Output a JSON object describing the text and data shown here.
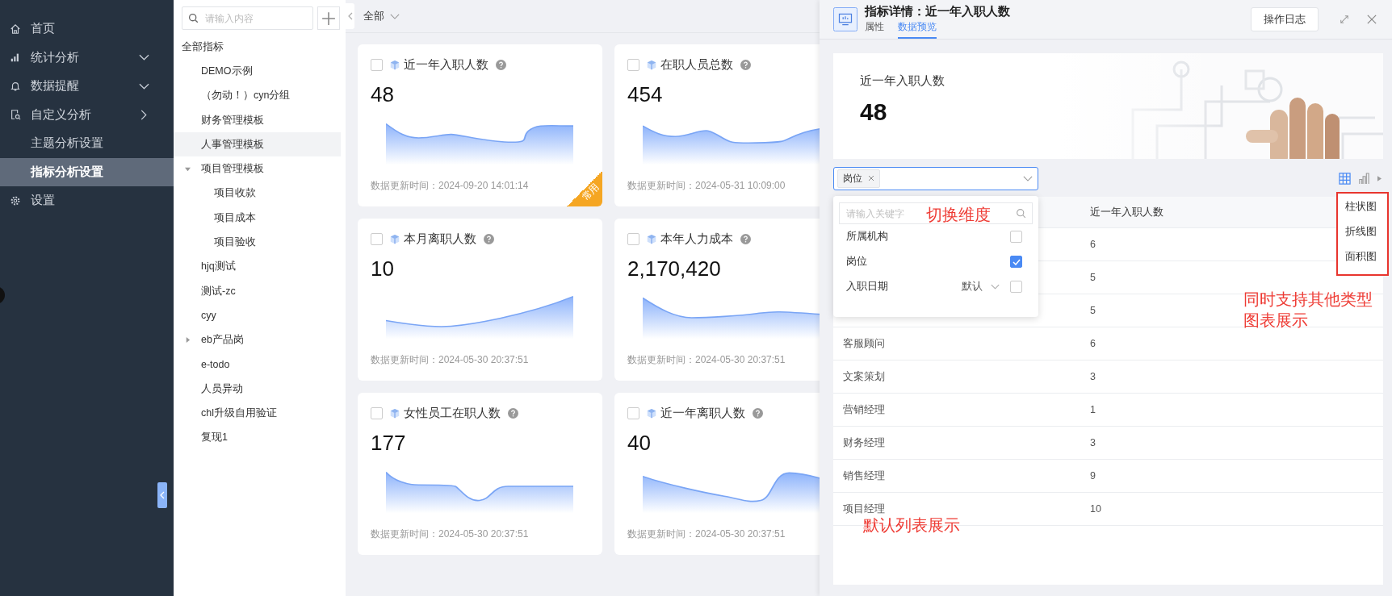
{
  "sidebar": {
    "items": [
      {
        "label": "首页",
        "kind": "top",
        "selected": false
      },
      {
        "label": "统计分析",
        "kind": "top",
        "expanded": true,
        "selected": false
      },
      {
        "label": "数据提醒",
        "kind": "top",
        "expanded": true,
        "selected": false
      },
      {
        "label": "自定义分析",
        "kind": "top",
        "expanded": false,
        "selected": false
      },
      {
        "label": "主题分析设置",
        "kind": "sub",
        "selected": false
      },
      {
        "label": "指标分析设置",
        "kind": "sub",
        "selected": true
      },
      {
        "label": "设置",
        "kind": "top",
        "selected": false
      }
    ]
  },
  "tree": {
    "search": {
      "placeholder": "请输入内容"
    },
    "items": [
      {
        "label": "全部指标",
        "selected": false,
        "children": [
          {
            "label": "DEMO示例",
            "selected": false
          },
          {
            "label": "（勿动！）cyn分组",
            "selected": false
          },
          {
            "label": "财务管理模板",
            "selected": false
          },
          {
            "label": "人事管理模板",
            "selected": true
          },
          {
            "label": "项目管理模板",
            "selected": false,
            "expanded": true,
            "children": [
              {
                "label": "项目收款",
                "selected": false
              },
              {
                "label": "项目成本",
                "selected": false
              },
              {
                "label": "项目验收",
                "selected": false
              }
            ]
          },
          {
            "label": "hjq测试",
            "selected": false
          },
          {
            "label": "测试-zc",
            "selected": false
          },
          {
            "label": "cyy",
            "selected": false
          },
          {
            "label": "eb产品岗",
            "selected": false,
            "expanded": false
          },
          {
            "label": "e-todo",
            "selected": false
          },
          {
            "label": "人员异动",
            "selected": false
          },
          {
            "label": "chl升级自用验证",
            "selected": false
          },
          {
            "label": "复现1",
            "selected": false
          }
        ]
      }
    ]
  },
  "filter": {
    "value": "全部"
  },
  "cards": [
    {
      "title": "近一年入职人数",
      "value": "48",
      "updated": "数据更新时间：2024-09-20 14:01:14",
      "checked": false,
      "badge": "常用"
    },
    {
      "title": "在职人员总数",
      "value": "454",
      "updated": "数据更新时间：2024-05-31 10:09:00",
      "checked": false
    },
    {
      "title": "本月离职人数",
      "value": "10",
      "updated": "数据更新时间：2024-05-30 20:37:51",
      "checked": false
    },
    {
      "title": "本年人力成本",
      "value": "2,170,420",
      "updated": "数据更新时间：2024-05-30 20:37:51",
      "checked": false
    },
    {
      "title": "女性员工在职人数",
      "value": "177",
      "updated": "数据更新时间：2024-05-30 20:37:51",
      "checked": false
    },
    {
      "title": "近一年离职人数",
      "value": "40",
      "updated": "数据更新时间：2024-05-30 20:37:51",
      "checked": false
    }
  ],
  "detail": {
    "title": "指标详情：近一年入职人数",
    "tabs": [
      {
        "label": "属性",
        "selected": false
      },
      {
        "label": "数据预览",
        "selected": true
      }
    ],
    "log_button": "操作日志",
    "summary": {
      "label": "近一年入职人数",
      "value": "48"
    },
    "dimension": {
      "tags": [
        "岗位"
      ]
    },
    "view_modes": [
      {
        "selected": true
      },
      {
        "selected": false
      }
    ],
    "dropdown": {
      "placeholder": "请输入关键字",
      "options": [
        {
          "label": "所属机构",
          "checked": false
        },
        {
          "label": "岗位",
          "checked": true
        },
        {
          "label": "入职日期",
          "checked": false,
          "select": "默认"
        }
      ]
    },
    "table": {
      "value_column": "近一年入职人数",
      "rows": [
        {
          "value": "6"
        },
        {
          "value": "5"
        },
        {
          "value": "5"
        },
        {
          "name": "客服顾问",
          "value": "6"
        },
        {
          "name": "文案策划",
          "value": "3"
        },
        {
          "name": "营销经理",
          "value": "1"
        },
        {
          "name": "财务经理",
          "value": "3"
        },
        {
          "name": "销售经理",
          "value": "9"
        },
        {
          "name": "项目经理",
          "value": "10"
        }
      ]
    },
    "chart_types": [
      "柱状图",
      "折线图",
      "面积图"
    ],
    "annotations": [
      "切换维度",
      "同时支持其他类型图表展示",
      "默认列表展示"
    ]
  }
}
